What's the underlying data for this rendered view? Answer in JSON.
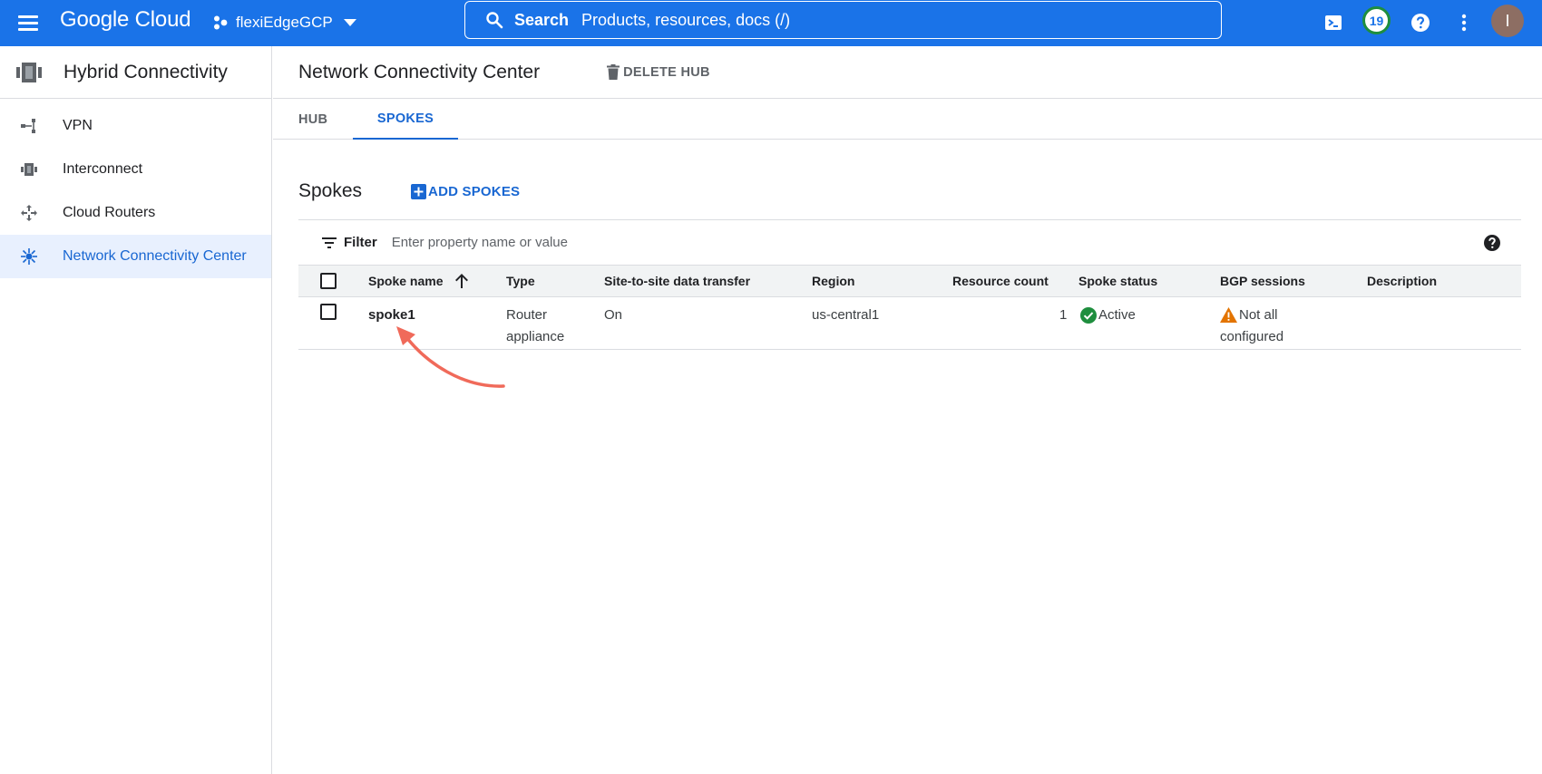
{
  "topbar": {
    "logo": "Google Cloud",
    "project": "flexiEdgeGCP",
    "search_label": "Search",
    "search_placeholder": "Products, resources, docs (/)",
    "notification_count": "19",
    "avatar_initial": "I"
  },
  "sidebar": {
    "title": "Hybrid Connectivity",
    "items": [
      {
        "label": "VPN"
      },
      {
        "label": "Interconnect"
      },
      {
        "label": "Cloud Routers"
      },
      {
        "label": "Network Connectivity Center"
      }
    ]
  },
  "page": {
    "title": "Network Connectivity Center",
    "delete_label": "DELETE HUB",
    "tabs": [
      {
        "label": "HUB"
      },
      {
        "label": "SPOKES"
      }
    ],
    "section_title": "Spokes",
    "add_label": "ADD SPOKES"
  },
  "filter": {
    "label": "Filter",
    "placeholder": "Enter property name or value"
  },
  "table": {
    "columns": {
      "name": "Spoke name",
      "type": "Type",
      "transfer": "Site-to-site data transfer",
      "region": "Region",
      "count": "Resource count",
      "status": "Spoke status",
      "bgp": "BGP sessions",
      "description": "Description"
    },
    "rows": [
      {
        "name": "spoke1",
        "type_line1": "Router",
        "type_line2": "appliance",
        "transfer": "On",
        "region": "us-central1",
        "count": "1",
        "status": "Active",
        "bgp_line1": "Not all",
        "bgp_line2": "configured",
        "description": ""
      }
    ]
  },
  "colors": {
    "brand": "#1a73e8",
    "active_link": "#1967d2",
    "success": "#1e8e3e",
    "warning": "#e37400",
    "annotation": "#f06a5a"
  }
}
